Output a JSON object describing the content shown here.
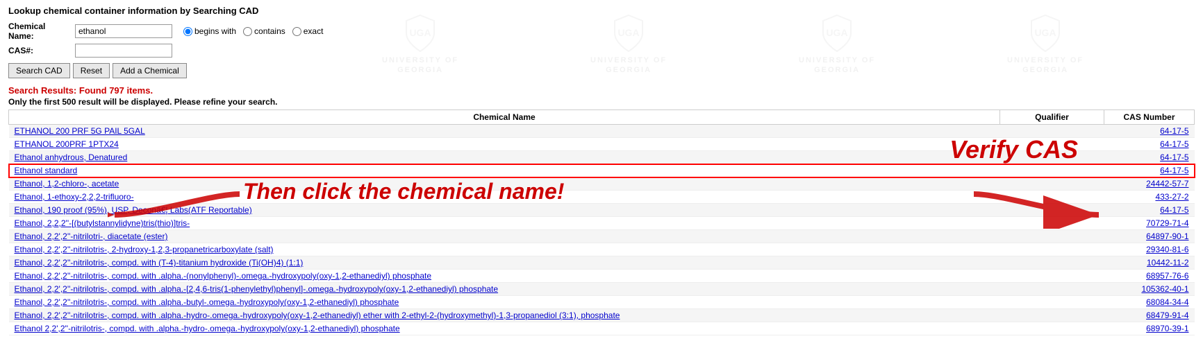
{
  "page": {
    "title": "Lookup chemical container information by Searching CAD"
  },
  "form": {
    "chemical_name_label": "Chemical Name:",
    "cas_label": "CAS#:",
    "chemical_name_value": "ethanol",
    "cas_value": "",
    "radio_begins_with_label": "begins with",
    "radio_contains_label": "contains",
    "radio_exact_label": "exact",
    "selected_radio": "begins with"
  },
  "buttons": {
    "search_cad": "Search CAD",
    "reset": "Reset",
    "add_chemical": "Add a Chemical"
  },
  "results": {
    "summary": "Search Results: Found 797 items.",
    "warning": "Only the first 500 result will be displayed. Please refine your search.",
    "columns": {
      "chemical_name": "Chemical Name",
      "qualifier": "Qualifier",
      "cas_number": "CAS Number"
    },
    "items": [
      {
        "name": "ETHANOL 200 PRF 5G PAIL 5GAL",
        "qualifier": "",
        "cas": "64-17-5",
        "highlighted": false
      },
      {
        "name": "ETHANOL 200PRF 1PTX24",
        "qualifier": "",
        "cas": "64-17-5",
        "highlighted": false
      },
      {
        "name": "Ethanol anhydrous, Denatured",
        "qualifier": "",
        "cas": "64-17-5",
        "highlighted": false
      },
      {
        "name": "Ethanol standard",
        "qualifier": "",
        "cas": "64-17-5",
        "highlighted": true
      },
      {
        "name": "Ethanol, 1,2-chloro-, acetate",
        "qualifier": "",
        "cas": "24442-57-7",
        "highlighted": false
      },
      {
        "name": "Ethanol, 1-ethoxy-2,2,2-trifluoro-",
        "qualifier": "",
        "cas": "433-27-2",
        "highlighted": false
      },
      {
        "name": "Ethanol, 190 proof (95%), USP, Deconâ€¦ Labs(ATF Reportable)",
        "qualifier": "",
        "cas": "64-17-5",
        "highlighted": false
      },
      {
        "name": "Ethanol, 2,2,2''-[(butylstannylidyne)tris(thio)]tris-",
        "qualifier": "",
        "cas": "70729-71-4",
        "highlighted": false
      },
      {
        "name": "Ethanol, 2,2',2''-nitrilotri-, diacetate (ester)",
        "qualifier": "",
        "cas": "64897-90-1",
        "highlighted": false
      },
      {
        "name": "Ethanol, 2,2',2''-nitrilotris-, 2-hydroxy-1,2,3-propanetricarboxylate (salt)",
        "qualifier": "",
        "cas": "29340-81-6",
        "highlighted": false
      },
      {
        "name": "Ethanol, 2,2',2''-nitrilotris-, compd. with (T-4)-titanium hydroxide (Ti(OH)4) (1:1)",
        "qualifier": "",
        "cas": "10442-11-2",
        "highlighted": false
      },
      {
        "name": "Ethanol, 2,2',2''-nitrilotris-, compd. with .alpha.-(nonylphenyl)-.omega.-hydroxypoly(oxy-1,2-ethanediyl) phosphate",
        "qualifier": "",
        "cas": "68957-76-6",
        "highlighted": false
      },
      {
        "name": "Ethanol, 2,2',2''-nitrilotris-, compd. with .alpha.-[2,4,6-tris(1-phenylethyl)phenyl]-.omega.-hydroxypoly(oxy-1,2-ethanediyl) phosphate",
        "qualifier": "",
        "cas": "105362-40-1",
        "highlighted": false
      },
      {
        "name": "Ethanol, 2,2',2''-nitrilotris-, compd. with .alpha.-butyl-.omega.-hydroxypoly(oxy-1,2-ethanediyl) phosphate",
        "qualifier": "",
        "cas": "68084-34-4",
        "highlighted": false
      },
      {
        "name": "Ethanol, 2,2',2''-nitrilotris-, compd. with .alpha.-hydro-.omega.-hydroxypoly(oxy-1,2-ethanediyl) ether with 2-ethyl-2-(hydroxymethyl)-1,3-propanediol (3:1), phosphate",
        "qualifier": "",
        "cas": "68479-91-4",
        "highlighted": false
      },
      {
        "name": "Ethanol 2,2',2''-nitrilotris-, compd. with .alpha.-hydro-.omega.-hydroxypoly(oxy-1,2-ethanediyl) phosphate",
        "qualifier": "",
        "cas": "68970-39-1",
        "highlighted": false
      }
    ]
  },
  "overlay": {
    "verify_cas": "Verify CAS",
    "click_chemical": "Then click the chemical name!"
  }
}
